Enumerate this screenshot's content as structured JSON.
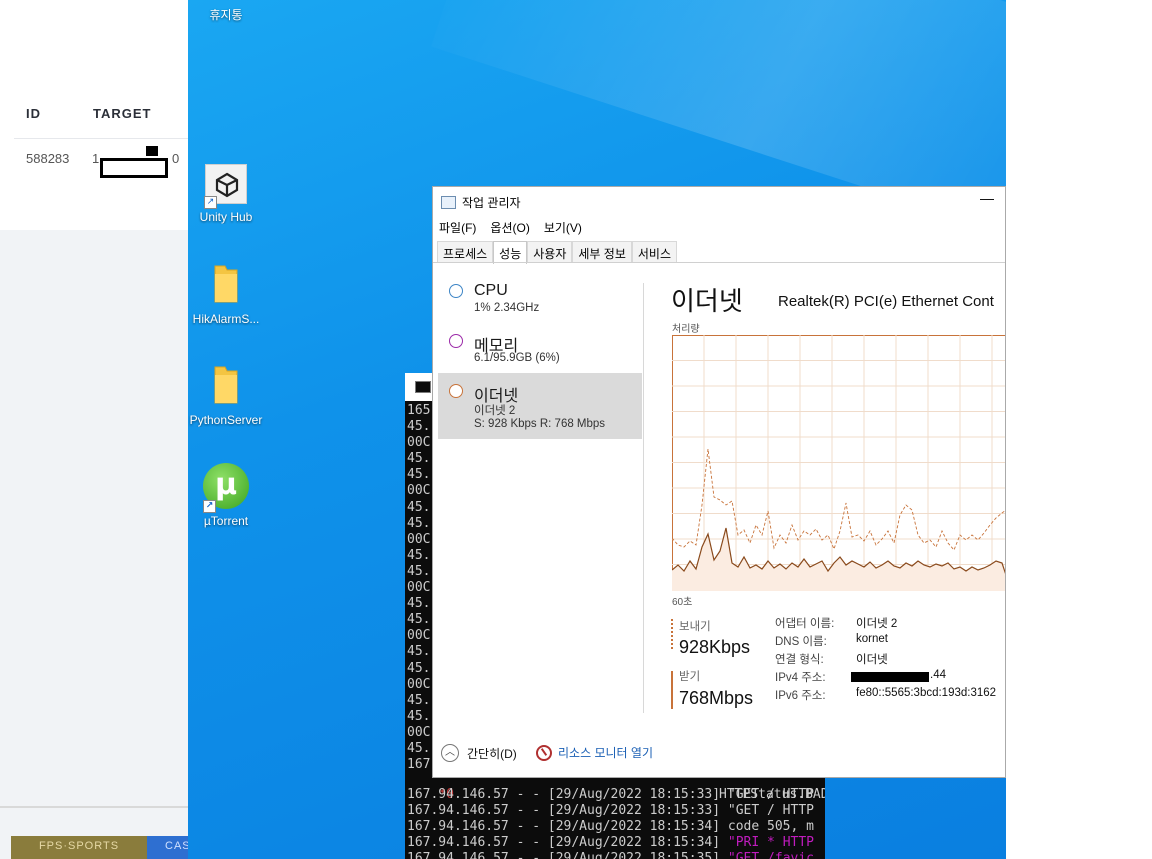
{
  "webpage": {
    "columns": [
      "ID",
      "TARGET"
    ],
    "row": {
      "id": "588283",
      "target": "1"
    },
    "target_suffix": "0",
    "tiles": [
      "FPS·SPORTS",
      "CAS"
    ]
  },
  "desktop": {
    "icons": [
      {
        "label": "휴지통",
        "icon": "recycle-bin-icon"
      },
      {
        "label": "Unity Hub",
        "icon": "unity-hub-icon"
      },
      {
        "label": "HikAlarmS...",
        "icon": "folder-icon"
      },
      {
        "label": "PythonServer",
        "icon": "folder-icon"
      },
      {
        "label": "µTorrent",
        "icon": "utorrent-icon"
      }
    ]
  },
  "console": {
    "prefix_lines": [
      "165",
      "45.",
      "00C",
      "45.",
      "45.",
      "00C",
      "45.",
      "45.",
      "00C",
      "45.",
      "45.",
      "00C",
      "45.",
      "45.",
      "00C",
      "45.",
      "45.",
      "00C",
      "45.",
      "45.",
      "00C",
      "45.",
      "167"
    ],
    "log_lines": [
      "167.94.146.57 - - [29/Aug/2022 18:15:33] \"GET / HTTP",
      "167.94.146.57 - - [29/Aug/2022 18:15:33] \"GET / HTTP",
      "167.94.146.57 - - [29/Aug/2022 18:15:34] code 505, m",
      "167.94.146.57 - - [29/Aug/2022 18:15:34] ",
      "167.94.146.57 - - [29/Aug/2022 18:15:35] "
    ],
    "status_fragment": "HTTPStatus.BAD_",
    "pri_fragment": "\"PRI * HTTP",
    "favicon_fragment": "\"GET /favic"
  },
  "taskmgr": {
    "title": "작업 관리자",
    "minimize": "—",
    "menu": [
      "파일(F)",
      "옵션(O)",
      "보기(V)"
    ],
    "tabs": [
      "프로세스",
      "성능",
      "사용자",
      "세부 정보",
      "서비스"
    ],
    "active_tab": "성능",
    "sidebar": [
      {
        "name": "CPU",
        "sub": "1% 2.34GHz",
        "color": "#3d85c6"
      },
      {
        "name": "메모리",
        "sub": "6.1/95.9GB (6%)",
        "color": "#9b2aa8"
      },
      {
        "name": "이더넷",
        "sub": "이더넷 2",
        "sub2": "S: 928 Kbps R: 768 Mbps",
        "color": "#c8733a"
      }
    ],
    "main": {
      "title": "이더넷",
      "adapter": "Realtek(R) PCI(e) Ethernet Cont",
      "throughput_label": "처리량",
      "time_label": "60초"
    },
    "send": {
      "label": "보내기",
      "value": "928Kbps"
    },
    "recv": {
      "label": "받기",
      "value": "768Mbps"
    },
    "props": [
      {
        "key": "어댑터 이름:",
        "value": "이더넷 2"
      },
      {
        "key": "DNS 이름:",
        "value": "kornet"
      },
      {
        "key": "연결 형식:",
        "value": "이더넷"
      },
      {
        "key": "IPv4 주소:",
        "value": ".44"
      },
      {
        "key": "IPv6 주소:",
        "value": "fe80::5565:3bcd:193d:3162"
      }
    ],
    "footer": {
      "fewer": "간단히(D)",
      "resmon": "리소스 모니터 열기"
    },
    "graph_color": "#c8733a"
  }
}
